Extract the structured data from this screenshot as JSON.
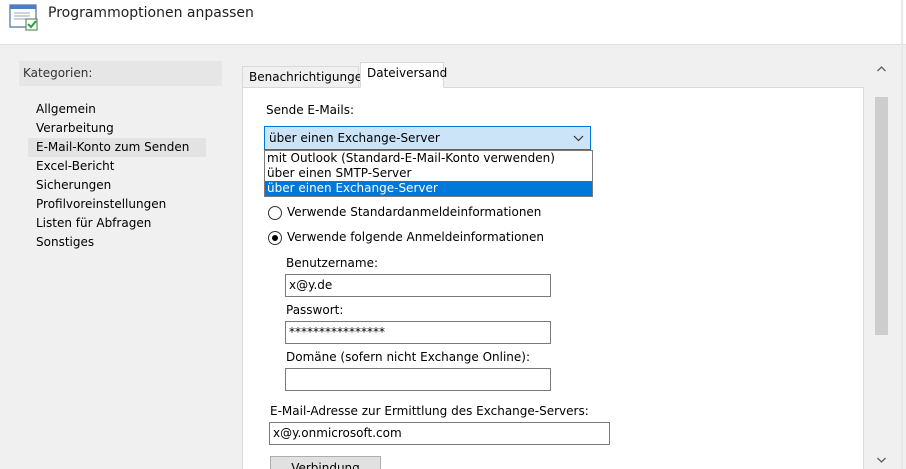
{
  "window": {
    "title": "Programmoptionen anpassen"
  },
  "categories": {
    "header": "Kategorien:",
    "items": [
      "Allgemein",
      "Verarbeitung",
      "E-Mail-Konto zum Senden",
      "Excel-Bericht",
      "Sicherungen",
      "Profilvoreinstellungen",
      "Listen für Abfragen",
      "Sonstiges"
    ],
    "selected": "E-Mail-Konto zum Senden"
  },
  "tabs": [
    {
      "label": "Benachrichtigungen"
    },
    {
      "label": "Dateiversand"
    }
  ],
  "form": {
    "send_label": "Sende E-Mails:",
    "send_value": "über einen Exchange-Server",
    "send_options": [
      "mit Outlook (Standard-E-Mail-Konto verwenden)",
      "über einen SMTP-Server",
      "über einen Exchange-Server"
    ],
    "radio_default": "Verwende Standardanmeldeinformationen",
    "radio_custom": "Verwende folgende Anmeldeinformationen",
    "username_label": "Benutzername:",
    "username_value": "x@y.de",
    "password_label": "Passwort:",
    "password_value": "****************",
    "domain_label": "Domäne (sofern nicht Exchange Online):",
    "domain_value": "",
    "exchange_label": "E-Mail-Adresse zur Ermittlung des Exchange-Servers:",
    "exchange_value": "x@y.onmicrosoft.com",
    "test_button": "Verbindung testen"
  },
  "icons": {
    "window": "settings-window-icon",
    "combo_arrow": "chevron-down-icon",
    "scroll_up": "scroll-up-arrow-icon",
    "scroll_down": "scroll-down-arrow-icon"
  },
  "colors": {
    "accent": "#0078d7",
    "combo_bg": "#cce4f7",
    "dialog_bg": "#f0f0f0"
  }
}
